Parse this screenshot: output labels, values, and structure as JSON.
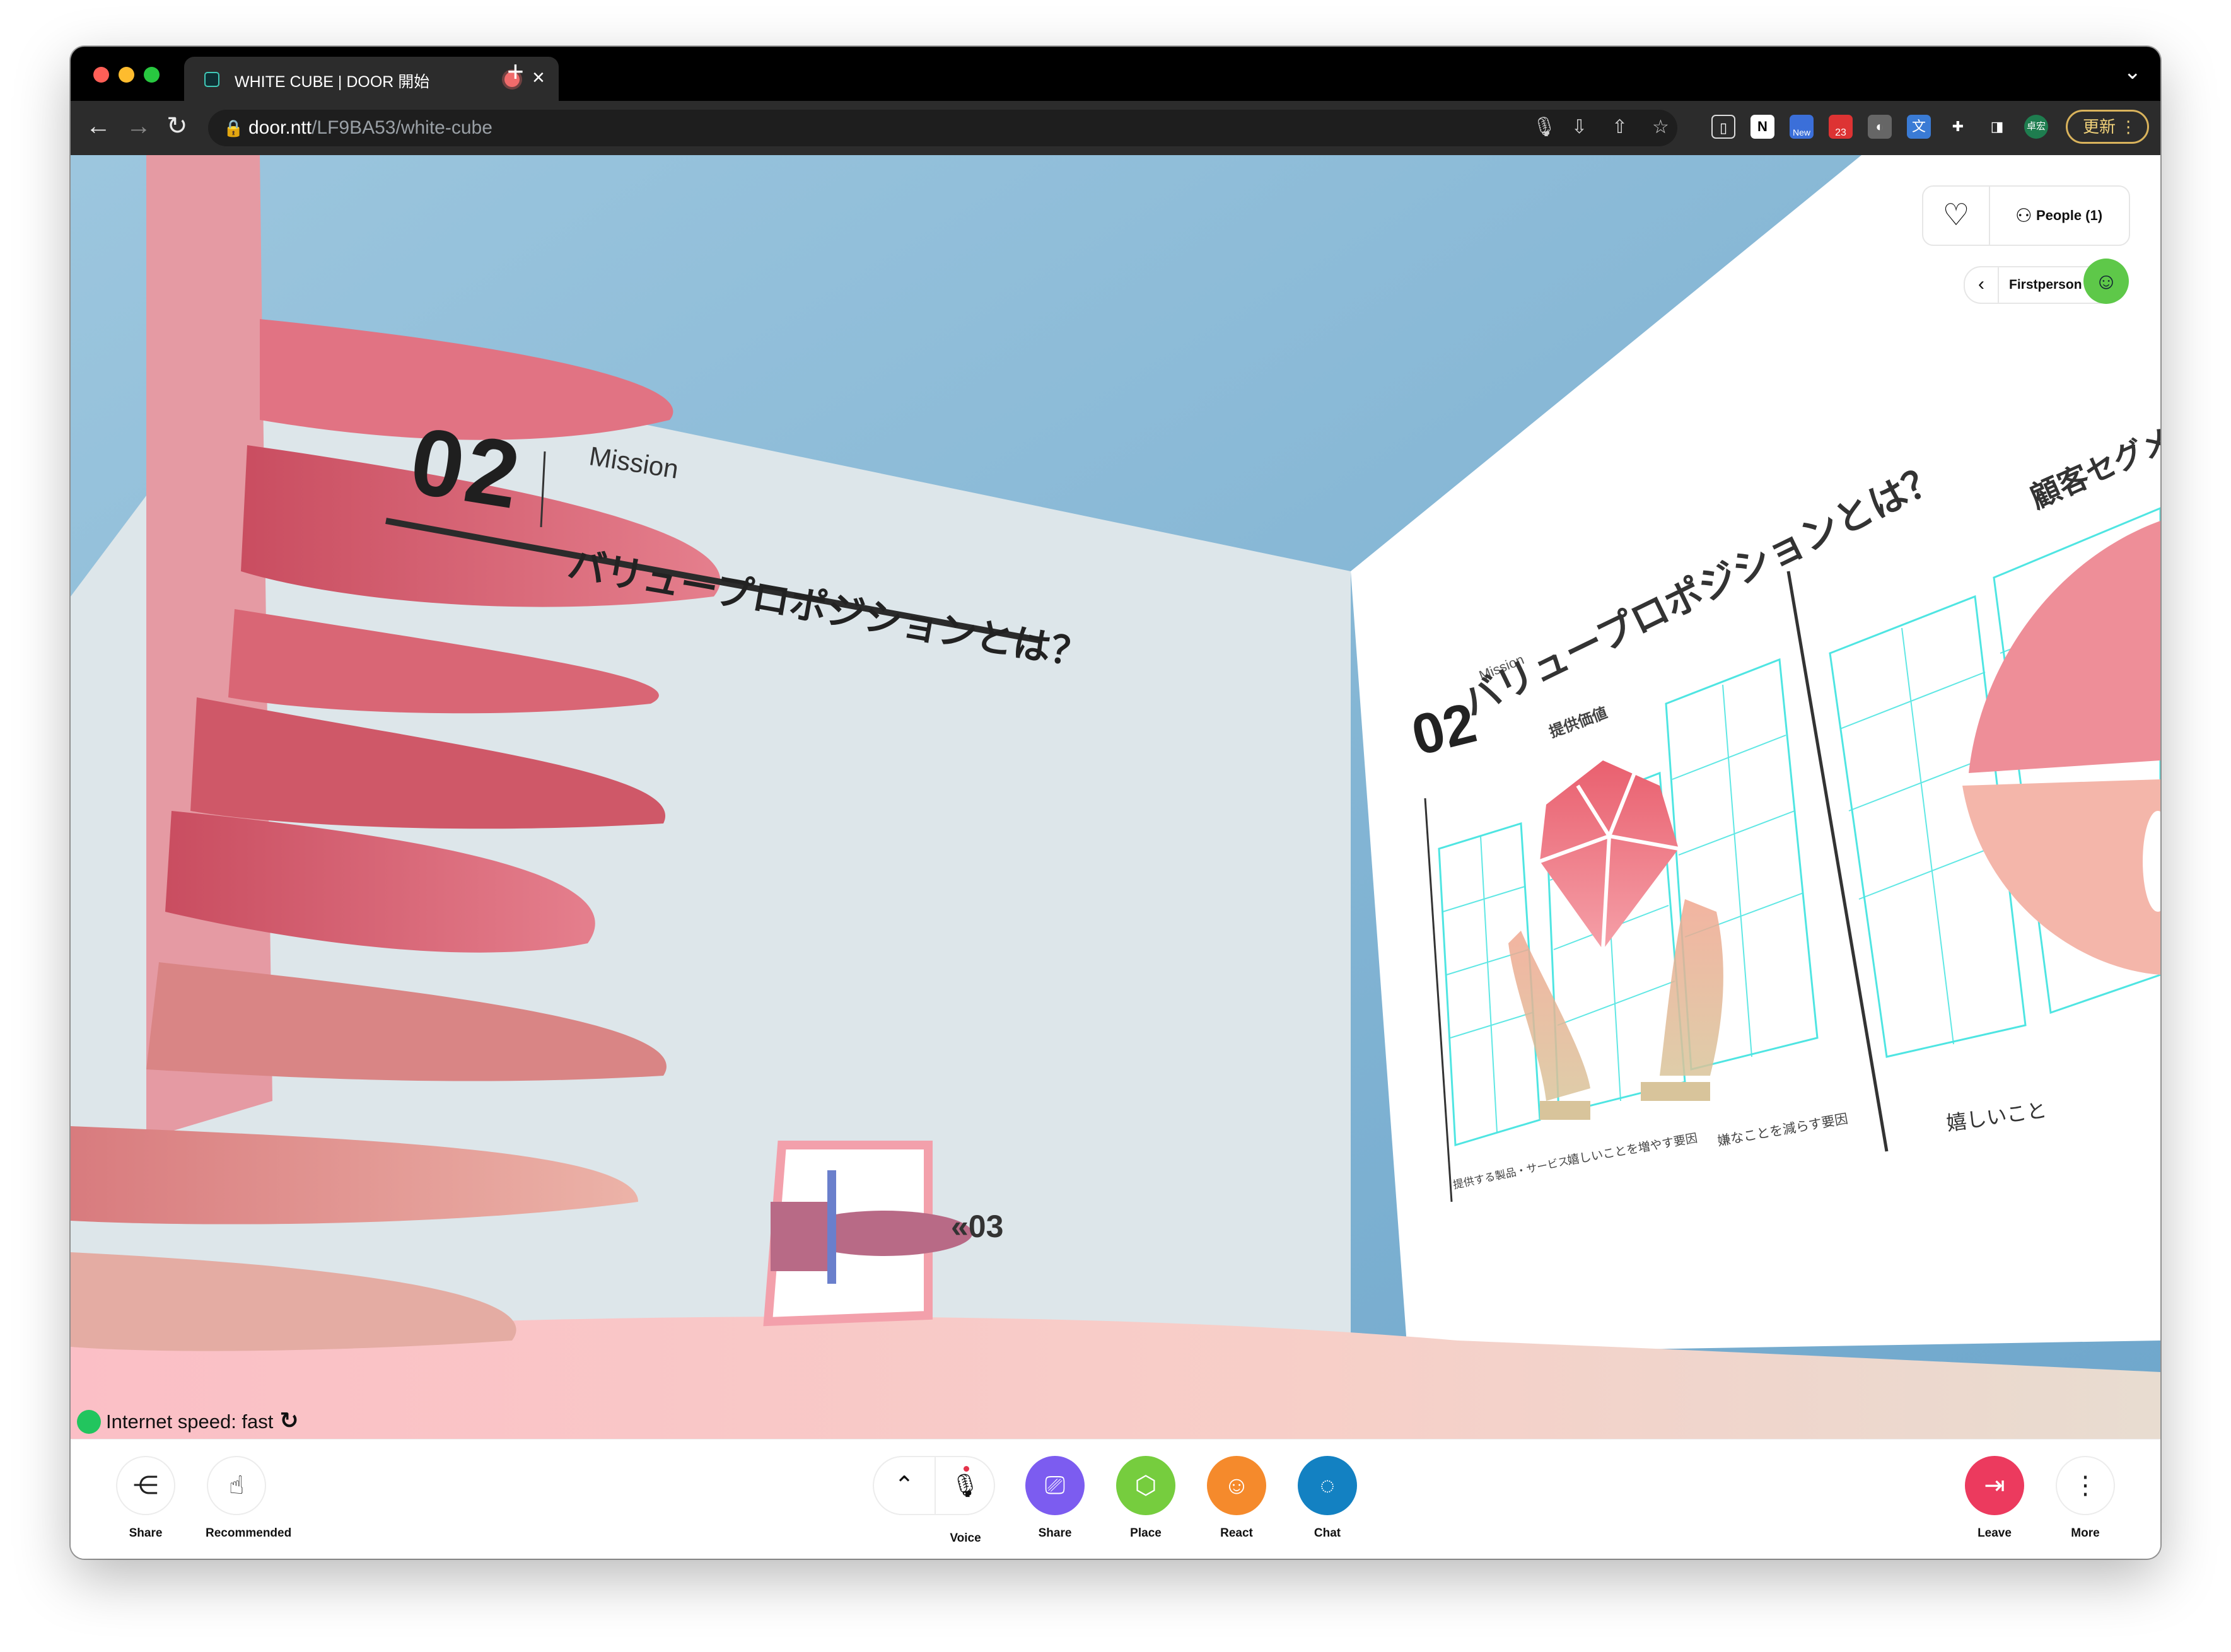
{
  "browser": {
    "tab_title": "WHITE CUBE | DOOR 開始",
    "tab_close": "×",
    "new_tab": "+",
    "url_host": "door.ntt",
    "url_path": "/LF9BA53/white-cube",
    "profile": "卓宏",
    "update_label": "更新",
    "ext_badge_new": "New",
    "ext_badge_count": "23",
    "ext_notion": "N"
  },
  "scene": {
    "left_number": "02",
    "left_label": "Mission",
    "left_heading": "バリュープロポジションとは？",
    "right_number": "02",
    "right_label": "Mission",
    "right_heading": "バリュープロポジションとは？",
    "right_sub_heading": "顧客セグメ",
    "provided_value": "提供価値",
    "canvas_label_1": "提供する製品・サービス",
    "canvas_label_2": "嬉しいことを増やす要因",
    "canvas_label_3": "嫌なことを減らす要因",
    "canvas_label_4": "嬉しいこと",
    "portal_label": "«03"
  },
  "overlay": {
    "people_label": "People (1)",
    "view_mode": "Firstperson",
    "internet_status": "Internet speed: fast"
  },
  "controls": {
    "left": [
      {
        "label": "Share",
        "icon": "share-icon"
      },
      {
        "label": "Recommended",
        "icon": "hand-pointer-icon"
      }
    ],
    "center": [
      {
        "label": "Voice",
        "icon": "mic-off-icon"
      },
      {
        "label": "Share",
        "icon": "screen-share-icon",
        "color": "#7c5cf0"
      },
      {
        "label": "Place",
        "icon": "cube-icon",
        "color": "#76cd3e"
      },
      {
        "label": "React",
        "icon": "smile-icon",
        "color": "#f58a2c"
      },
      {
        "label": "Chat",
        "icon": "chat-bubble-icon",
        "color": "#1381c2"
      }
    ],
    "right": [
      {
        "label": "Leave",
        "icon": "exit-icon",
        "color": "#ec3a5e"
      },
      {
        "label": "More",
        "icon": "more-vertical-icon"
      }
    ]
  },
  "colors": {
    "sky": "#7fb3d3",
    "wall": "#dde6ea",
    "pink": "#d85a6a",
    "accent_green": "#22c55e"
  }
}
